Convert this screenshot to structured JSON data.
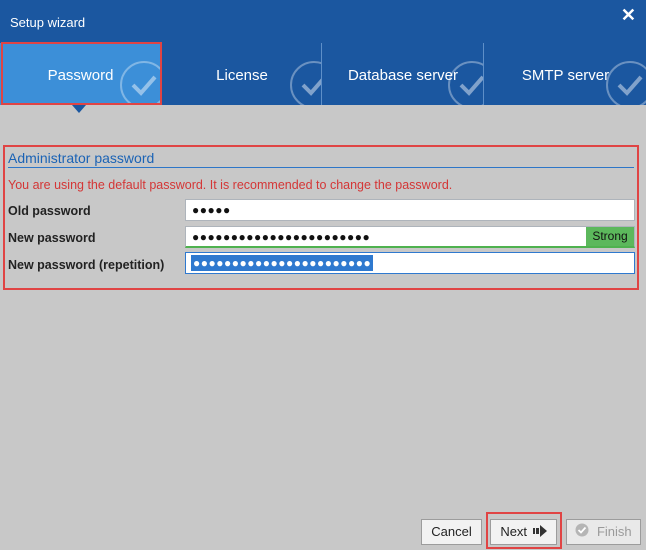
{
  "window": {
    "title": "Setup wizard"
  },
  "tabs": [
    {
      "label": "Password"
    },
    {
      "label": "License"
    },
    {
      "label": "Database server"
    },
    {
      "label": "SMTP server"
    }
  ],
  "section": {
    "title": "Administrator password",
    "warning": "You are using the default password. It is recommended to change the password."
  },
  "fields": {
    "old_label": "Old password",
    "old_value": "●●●●●",
    "new_label": "New password",
    "new_value": "●●●●●●●●●●●●●●●●●●●●●●●",
    "strength": "Strong",
    "repeat_label": "New password (repetition)",
    "repeat_value": "●●●●●●●●●●●●●●●●●●●●●●●"
  },
  "buttons": {
    "cancel": "Cancel",
    "next": "Next",
    "finish": "Finish"
  },
  "colors": {
    "titlebar": "#1b57a0",
    "active_tab": "#3c8fd8",
    "warning": "#d43636",
    "highlight": "#e04444",
    "strong": "#5cb85c"
  }
}
